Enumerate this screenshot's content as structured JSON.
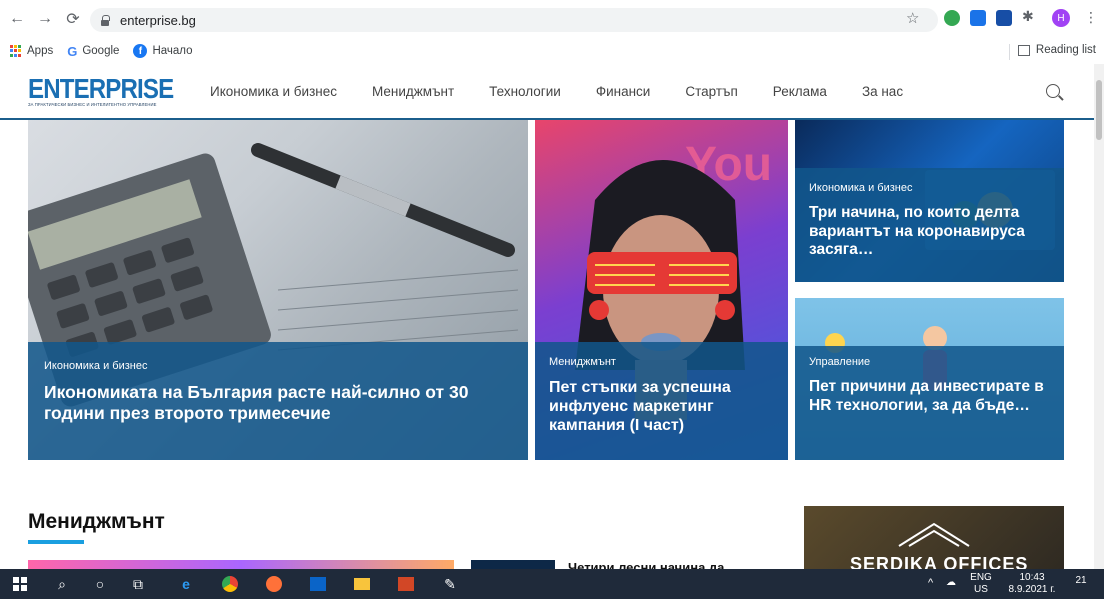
{
  "browser": {
    "url": "enterprise.bg",
    "profile_initial": "H",
    "bookmarks": [
      {
        "label": "Apps",
        "icon": "apps-grid-icon"
      },
      {
        "label": "Google",
        "icon": "google-icon"
      },
      {
        "label": "Начало",
        "icon": "facebook-icon"
      }
    ],
    "reading_list": "Reading list"
  },
  "site": {
    "logo": "ENTERPRISE",
    "logo_tagline": "ЗА ПРАКТИЧЕСКИ БИЗНЕС И ИНТЕЛИГЕНТНО УПРАВЛЕНИЕ",
    "menu": [
      "Икономика и бизнес",
      "Мениджмънт",
      "Технологии",
      "Финанси",
      "Стартъп",
      "Реклама",
      "За нас"
    ]
  },
  "featured": [
    {
      "category": "Икономика и бизнес",
      "title": "Икономиката на България расте най-силно от 30 години през второто тримесечие"
    },
    {
      "category": "Мениджмънт",
      "title": "Пет стъпки за успешна инфлуенс маркетинг кампания (I част)"
    },
    {
      "category": "Икономика и бизнес",
      "title": "Три начина, по които делта вариантът на коронавируса засяга…"
    },
    {
      "category": "Управление",
      "title": "Пет причини да инвестирате в HR технологии, за да бъде…"
    }
  ],
  "section": {
    "title": "Мениджмънт",
    "partial_article": "Четири лесни начина да",
    "ad_text": "SERDIKA OFFICES"
  },
  "taskbar": {
    "lang_top": "ENG",
    "lang_bottom": "US",
    "time": "10:43",
    "date": "8.9.2021 г.",
    "notifications": "21"
  },
  "colors": {
    "brand_blue": "#1a6fb3",
    "overlay": "#12568a",
    "accent": "#1a9fe0"
  }
}
